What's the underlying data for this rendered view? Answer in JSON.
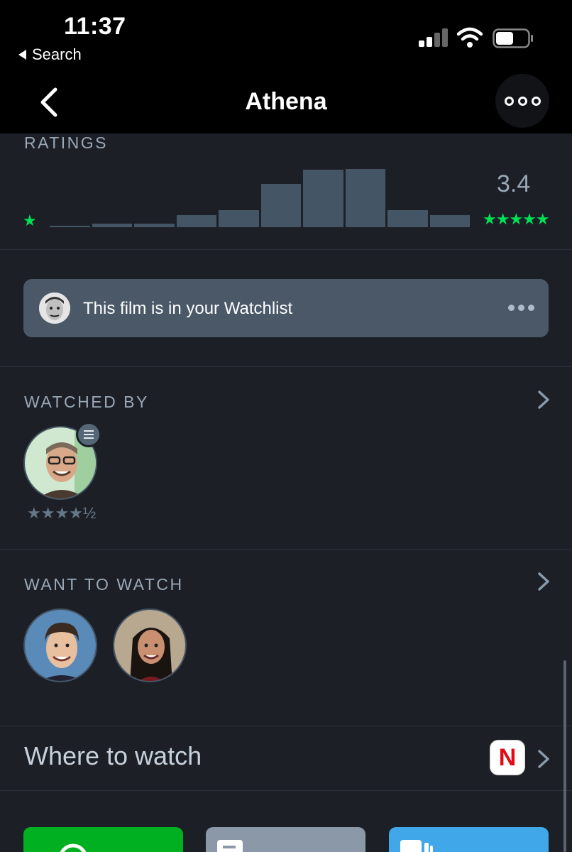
{
  "status_bar": {
    "time": "11:37",
    "back_label": "Search"
  },
  "nav": {
    "title": "Athena"
  },
  "ratings": {
    "label": "RATINGS",
    "average": "3.4",
    "min_stars": "★",
    "max_stars": "★★★★★",
    "histogram": [
      2,
      4,
      4,
      14,
      20,
      50,
      66,
      67,
      20,
      14
    ],
    "colors": {
      "bar": "#445566",
      "accent": "#00e054"
    }
  },
  "watchlist": {
    "text": "This film is in your Watchlist"
  },
  "watched_by": {
    "label": "WATCHED BY",
    "members": [
      {
        "avatar": "man-glasses-avatar",
        "rating": "★★★★½"
      }
    ]
  },
  "want_to_watch": {
    "label": "WANT TO WATCH",
    "members": [
      {
        "avatar": "man-avatar"
      },
      {
        "avatar": "woman-avatar"
      }
    ]
  },
  "where_to_watch": {
    "label": "Where to watch",
    "service_letter": "N"
  },
  "tiles": [
    {
      "color": "#00b020"
    },
    {
      "color": "#8a98a8"
    },
    {
      "color": "#40a8e8"
    }
  ]
}
